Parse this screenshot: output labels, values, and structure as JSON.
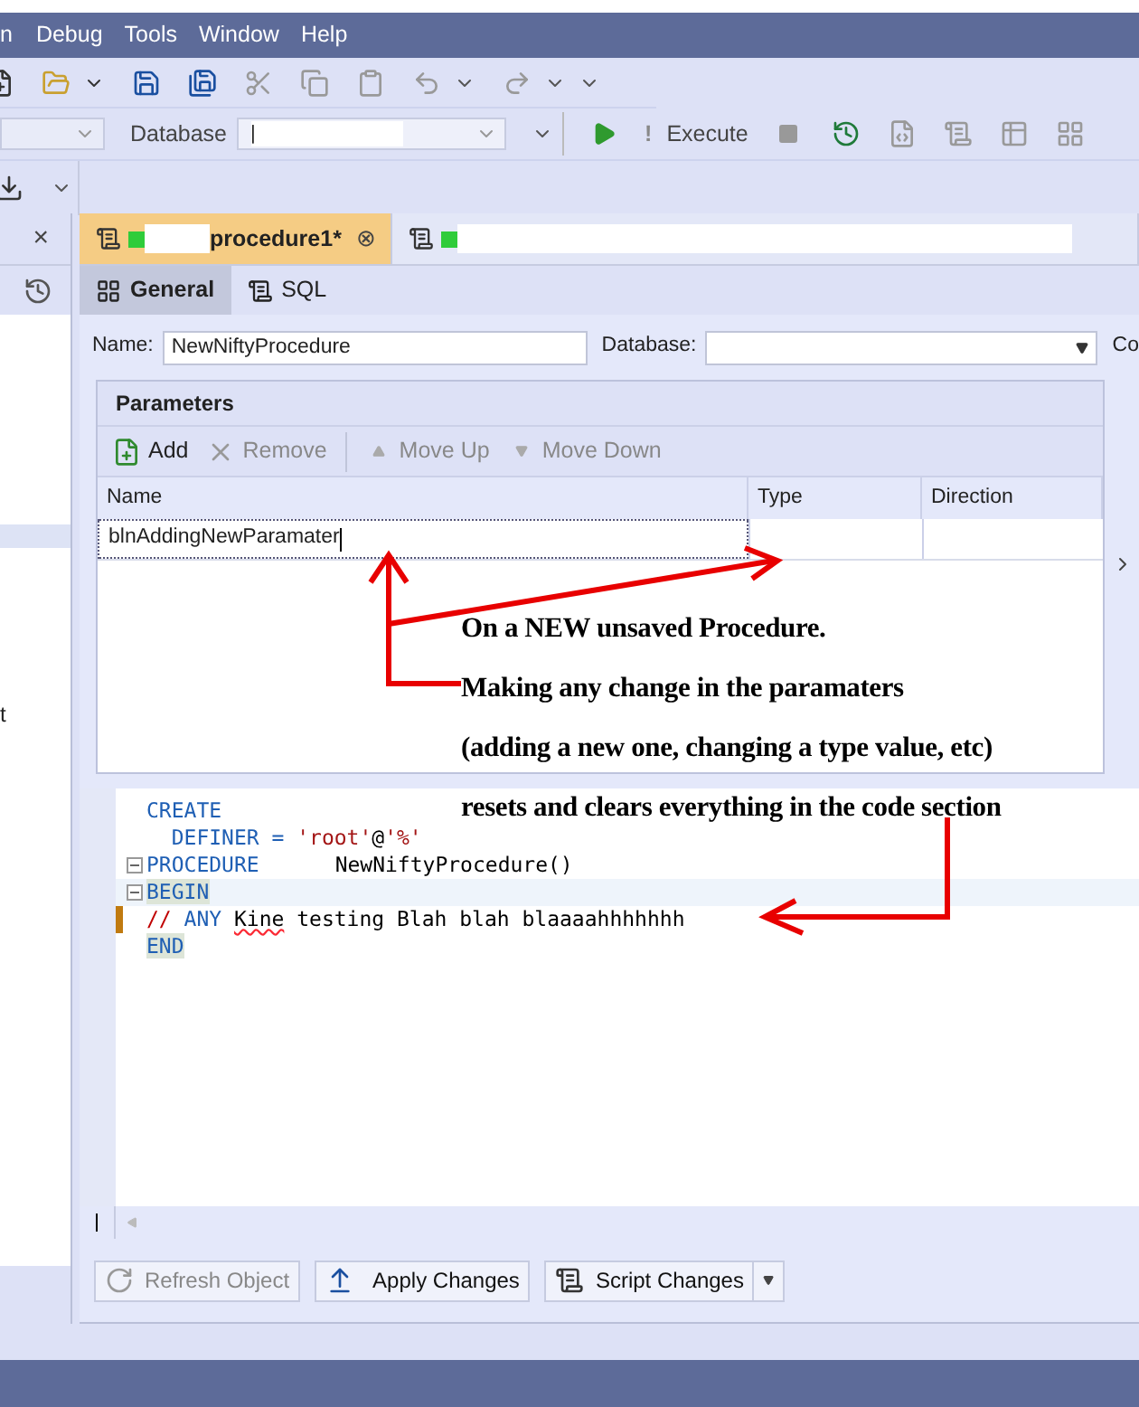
{
  "menu": [
    "n",
    "Debug",
    "Tools",
    "Window",
    "Help"
  ],
  "toolbar": {
    "database_label": "Database",
    "database_value": "|",
    "execute_icon": "!",
    "execute": "Execute"
  },
  "left_panel": {
    "close": "×",
    "text": "t"
  },
  "doc_tabs": [
    {
      "label": "procedure1*",
      "selected": true,
      "close": "⊗"
    },
    {
      "selected": false
    }
  ],
  "sub_tabs": [
    {
      "label": "General",
      "selected": true
    },
    {
      "label": "SQL",
      "selected": false
    }
  ],
  "form": {
    "name_label": "Name:",
    "name_value": "NewNiftyProcedure",
    "database_label": "Database:",
    "cut_label": "Co"
  },
  "parameters": {
    "title": "Parameters",
    "actions": [
      {
        "label": "Add",
        "disabled": false
      },
      {
        "label": "Remove",
        "disabled": true
      },
      {
        "label": "Move Up",
        "disabled": true
      },
      {
        "label": "Move Down",
        "disabled": true
      }
    ],
    "columns": [
      "Name",
      "Type",
      "Direction"
    ],
    "rows": [
      {
        "name": "blnAddingNewParamater",
        "editing": true
      }
    ]
  },
  "code": [
    {
      "fold": false,
      "current": false,
      "modified": false,
      "tokens": [
        {
          "text": "CREATE",
          "kind": "keyword"
        }
      ]
    },
    {
      "fold": false,
      "current": false,
      "modified": false,
      "tokens": [
        {
          "text": "  DEFINER = ",
          "kind": "keyword"
        },
        {
          "text": "'root'",
          "kind": "string"
        },
        {
          "text": "@",
          "kind": "plain"
        },
        {
          "text": "'%'",
          "kind": "string"
        }
      ]
    },
    {
      "fold": true,
      "current": false,
      "modified": false,
      "tokens": [
        {
          "text": "PROCEDURE",
          "kind": "keyword"
        },
        {
          "text": "NewNiftyProcedure()",
          "kind": "name"
        }
      ]
    },
    {
      "fold": true,
      "current": true,
      "modified": false,
      "tokens": [
        {
          "text": "BEGIN",
          "kind": "block"
        }
      ]
    },
    {
      "fold": false,
      "current": false,
      "modified": true,
      "tokens": [
        {
          "text": "//",
          "kind": "comment"
        },
        {
          "text": " ANY ",
          "kind": "keyword"
        },
        {
          "text": "Kine",
          "kind": "misspelled"
        },
        {
          "text": " testing Blah blah blaaaahhhhhhh",
          "kind": "plain"
        }
      ]
    },
    {
      "fold": false,
      "current": false,
      "modified": false,
      "tokens": [
        {
          "text": "END",
          "kind": "block"
        }
      ]
    }
  ],
  "buttons": [
    {
      "label": "Refresh Object",
      "disabled": true,
      "dropdown": false
    },
    {
      "label": "Apply Changes",
      "disabled": false,
      "dropdown": false
    },
    {
      "label": "Script Changes",
      "disabled": false,
      "dropdown": true
    }
  ],
  "annotation": [
    "On a NEW unsaved Procedure.",
    "Making any change in the paramaters",
    "(adding a new one, changing a type value, etc)",
    "resets and clears everything in the code section"
  ]
}
